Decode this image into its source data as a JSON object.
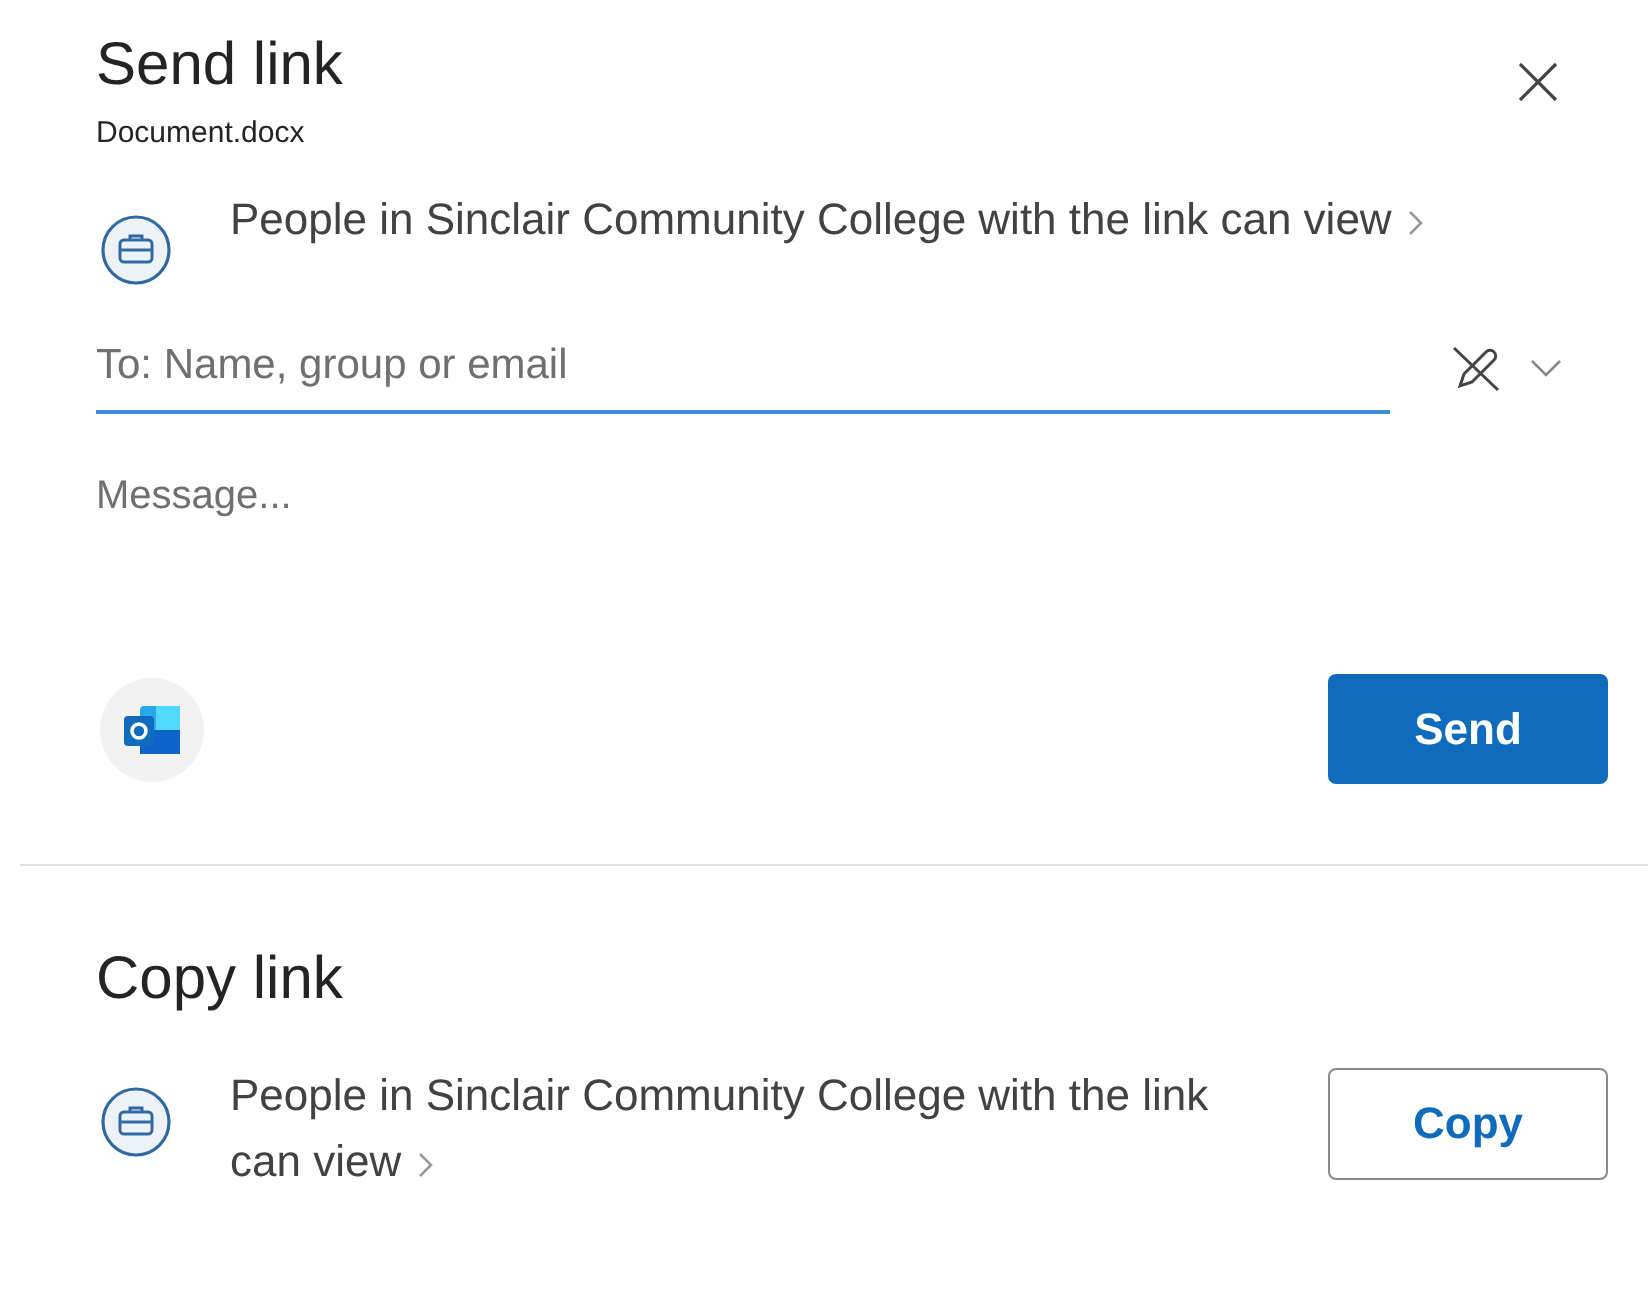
{
  "send_link": {
    "title": "Send link",
    "file_name": "Document.docx",
    "permission": "People in Sinclair Community College with the link can view",
    "to_field": {
      "placeholder": "To: Name, group or email",
      "focused": true
    },
    "message": {
      "placeholder": "Message..."
    },
    "send_button": "Send"
  },
  "copy_link": {
    "title": "Copy link",
    "permission": "People in Sinclair Community College with the link can view",
    "copy_button": "Copy"
  }
}
